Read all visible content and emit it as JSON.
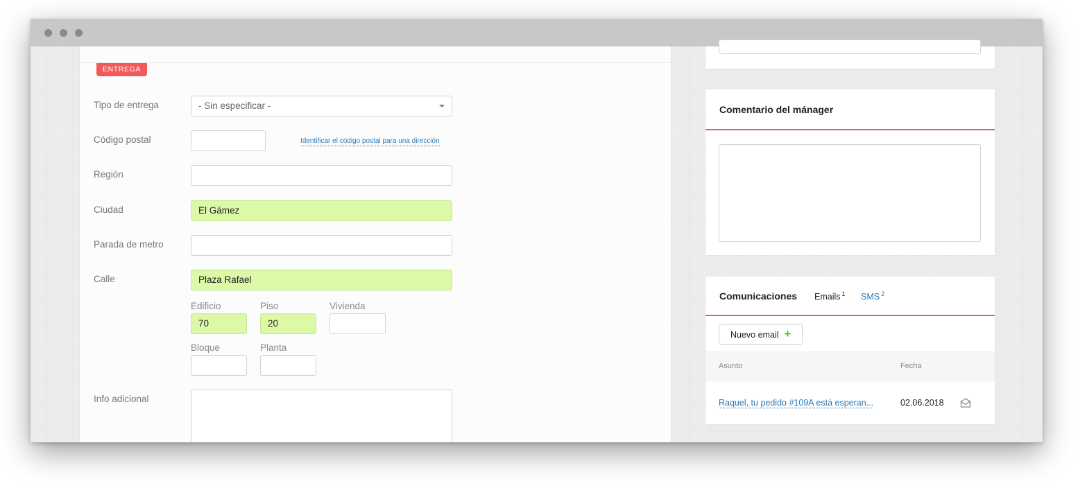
{
  "window": {
    "titlebar_dots": 3
  },
  "delivery": {
    "tag": "ENTREGA",
    "delivery_type": {
      "label": "Tipo de entrega",
      "value": "- Sin especificar -"
    },
    "postal_code": {
      "label": "Código postal",
      "value": "",
      "link": "Identificar el código postal para una dirección"
    },
    "region": {
      "label": "Región",
      "value": ""
    },
    "city": {
      "label": "Ciudad",
      "value": "El Gámez"
    },
    "metro": {
      "label": "Parada de metro",
      "value": ""
    },
    "street": {
      "label": "Calle",
      "value": "Plaza Rafael"
    },
    "building": {
      "label": "Edificio",
      "value": "70"
    },
    "floor": {
      "label": "Piso",
      "value": "20"
    },
    "apartment": {
      "label": "Vivienda",
      "value": ""
    },
    "block": {
      "label": "Bloque",
      "value": ""
    },
    "level": {
      "label": "Planta",
      "value": ""
    },
    "additional_info": {
      "label": "Info adicional",
      "value": ""
    }
  },
  "manager_comment": {
    "title": "Comentario del mánager",
    "value": ""
  },
  "communications": {
    "title": "Comunicaciones",
    "tabs": [
      {
        "label": "Emails",
        "count": "1"
      },
      {
        "label": "SMS",
        "count": "2"
      }
    ],
    "new_email_label": "Nuevo email",
    "plus": "+",
    "columns": {
      "subject": "Asunto",
      "date": "Fecha"
    },
    "rows": [
      {
        "subject": "Raquel, tu pedido #109A está esperan...",
        "date": "02.06.2018",
        "icon": "envelope-icon"
      }
    ]
  },
  "colors": {
    "accent": "#f25a5a",
    "filled": "#dcf9a8",
    "link": "#2a7ab8"
  }
}
